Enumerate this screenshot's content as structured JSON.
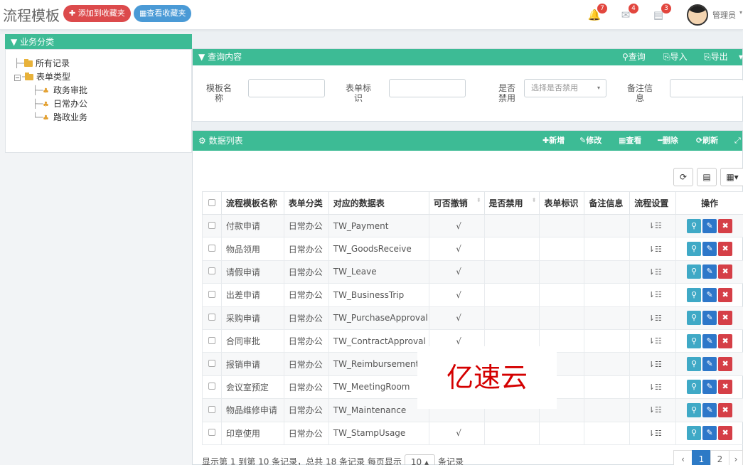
{
  "header": {
    "title": "流程模板",
    "add_favorite_label": "添加到收藏夹",
    "view_favorite_label": "查看收藏夹",
    "notifications": [
      {
        "icon": "bell-icon",
        "count": "7"
      },
      {
        "icon": "envelope-icon",
        "count": "4"
      },
      {
        "icon": "task-icon",
        "count": "3"
      }
    ],
    "user": "管理员"
  },
  "sidebar": {
    "title": "业务分类",
    "tree": [
      {
        "label": "所有记录"
      },
      {
        "label": "表单类型",
        "children": [
          "政务审批",
          "日常办公",
          "路政业务"
        ]
      }
    ]
  },
  "query": {
    "title": "查询内容",
    "actions": [
      "查询",
      "导入",
      "导出"
    ],
    "fields": [
      {
        "label": "模板名称",
        "placeholder": ""
      },
      {
        "label": "表单标识",
        "placeholder": ""
      },
      {
        "label": "是否禁用",
        "placeholder": "选择是否禁用"
      },
      {
        "label": "备注信息",
        "placeholder": ""
      }
    ]
  },
  "datalist": {
    "title": "数据列表",
    "actions": [
      "新增",
      "修改",
      "查看",
      "删除",
      "刷新"
    ],
    "columns": [
      "流程模板名称",
      "表单分类",
      "对应的数据表",
      "可否撤销",
      "是否禁用",
      "表单标识",
      "备注信息",
      "流程设置",
      "操作"
    ],
    "rows": [
      {
        "name": "付款申请",
        "category": "日常办公",
        "table": "TW_Payment",
        "revocable": "√"
      },
      {
        "name": "物品领用",
        "category": "日常办公",
        "table": "TW_GoodsReceive",
        "revocable": "√"
      },
      {
        "name": "请假申请",
        "category": "日常办公",
        "table": "TW_Leave",
        "revocable": "√"
      },
      {
        "name": "出差申请",
        "category": "日常办公",
        "table": "TW_BusinessTrip",
        "revocable": "√"
      },
      {
        "name": "采购申请",
        "category": "日常办公",
        "table": "TW_PurchaseApproval",
        "revocable": "√"
      },
      {
        "name": "合同审批",
        "category": "日常办公",
        "table": "TW_ContractApproval",
        "revocable": "√"
      },
      {
        "name": "报销申请",
        "category": "日常办公",
        "table": "TW_Reimbursement",
        "revocable": ""
      },
      {
        "name": "会议室预定",
        "category": "日常办公",
        "table": "TW_MeetingRoom",
        "revocable": ""
      },
      {
        "name": "物品维修申请",
        "category": "日常办公",
        "table": "TW_Maintenance",
        "revocable": ""
      },
      {
        "name": "印章使用",
        "category": "日常办公",
        "table": "TW_StampUsage",
        "revocable": "√"
      }
    ],
    "pagination": {
      "info_prefix": "显示第 1 到第 10 条记录，总共 18 条记录 每页显示",
      "page_size": "10",
      "info_suffix": "条记录",
      "pages": [
        "‹",
        "1",
        "2",
        "›"
      ],
      "current": "1"
    }
  },
  "watermark": "亿速云",
  "colors": {
    "accent": "#3dbb95",
    "danger": "#dc4a4c",
    "primary": "#2d7ac6"
  }
}
